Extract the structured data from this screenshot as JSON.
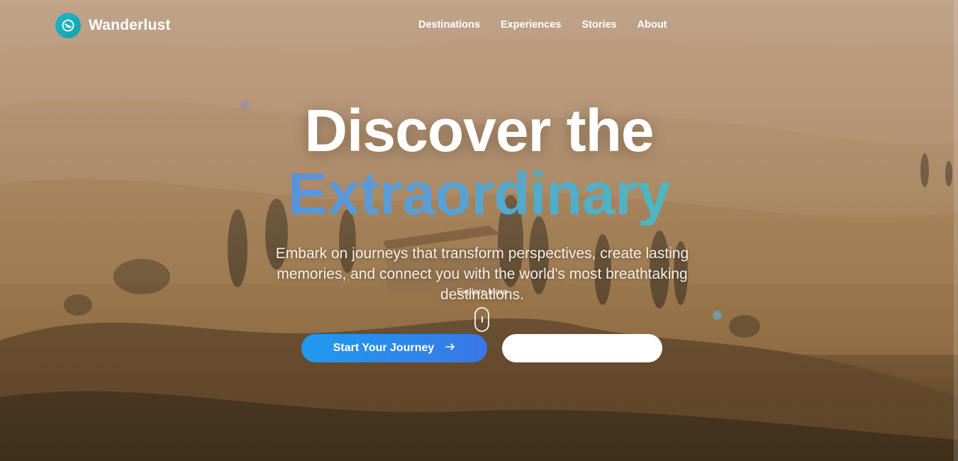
{
  "brand": {
    "name": "Wanderlust",
    "logo_icon": "compass-icon"
  },
  "nav": {
    "items": [
      "Destinations",
      "Experiences",
      "Stories",
      "About"
    ]
  },
  "hero": {
    "title_line1": "Discover the",
    "title_line2": "Extraordinary",
    "subtitle": "Embark on journeys that transform perspectives, create lasting memories, and connect you with the world's most breathtaking destinations.",
    "scroll_label": "Explore More"
  },
  "buttons": {
    "primary_label": "Start Your Journey",
    "primary_icon": "arrow-right-icon",
    "secondary_label": ""
  },
  "colors": {
    "accent_gradient_start": "#1e9bef",
    "accent_gradient_end": "#3a76e6",
    "logo_badge": "#1eb7c9",
    "title_gradient": [
      "#4c80e6",
      "#4cb8c0",
      "#4fc99a"
    ]
  }
}
